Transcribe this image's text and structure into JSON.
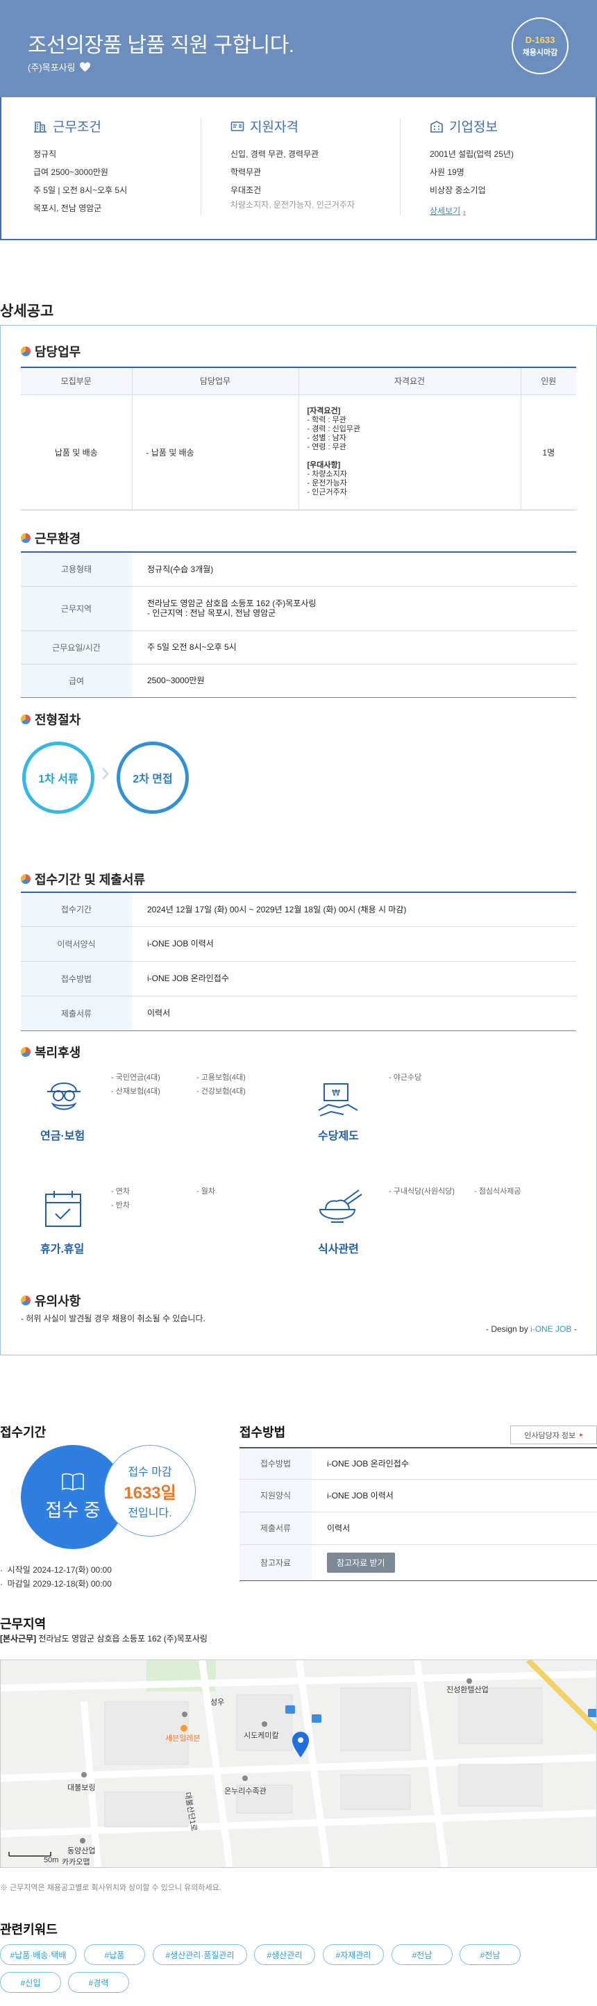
{
  "header": {
    "title": "조선의장품 납품 직원 구합니다.",
    "company": "(주)목포사링",
    "dday": "D-1633",
    "dday_label": "채용시마감"
  },
  "summary": {
    "work": {
      "heading": "근무조건",
      "lines": [
        "정규직",
        "급여 2500~3000만원",
        "주 5일 | 오전 8시~오후 5시",
        "목포시, 전남 영암군"
      ]
    },
    "qualify": {
      "heading": "지원자격",
      "lines": [
        "신입, 경력 무관, 경력무관",
        "학력무관",
        "우대조건"
      ],
      "sub": "차량소지자, 운전가능자, 인근거주자"
    },
    "company": {
      "heading": "기업정보",
      "lines": [
        "2001년 설립(업력 25년)",
        "사원 19명",
        "비상장 중소기업"
      ],
      "more": "상세보기"
    }
  },
  "detail": {
    "title": "상세공고",
    "duty": {
      "title": "담당업무",
      "headers": [
        "모집부문",
        "담당업무",
        "자격요건",
        "인원"
      ],
      "row": {
        "part": "납품 및 배송",
        "task": "- 납품 및 배송",
        "req_title": "[자격요건]",
        "req_lines": [
          "- 학력 : 무관",
          "- 경력 : 신입무관",
          "- 성별 : 남자",
          "- 연령 : 무관"
        ],
        "pref_title": "[우대사항]",
        "pref_lines": [
          "- 차량소지자",
          "- 운전가능자",
          "- 인근거주자"
        ],
        "count": "1명"
      }
    },
    "env": {
      "title": "근무환경",
      "rows": [
        {
          "k": "고용형태",
          "v": "정규직(수습 3개월)"
        },
        {
          "k": "근무지역",
          "v": "전라남도 영암군 삼호읍 소등포 162 (주)목포사링",
          "v2": "- 인근지역 : 전남 목포시, 전남 영암군"
        },
        {
          "k": "근무요일/시간",
          "v": "주 5일 오전 8시~오후 5시"
        },
        {
          "k": "급여",
          "v": "2500~3000만원"
        }
      ]
    },
    "process": {
      "title": "전형절차",
      "steps": [
        "1차 서류",
        "2차 면접"
      ]
    },
    "docs": {
      "title": "접수기간 및 제출서류",
      "rows": [
        {
          "k": "접수기간",
          "v": "2024년 12월 17일 (화) 00시 ~ 2029년 12월 18일 (화) 00시 (채용 시 마감)"
        },
        {
          "k": "이력서양식",
          "v": "i-ONE JOB 이력서"
        },
        {
          "k": "접수방법",
          "v": "i-ONE JOB 온라인접수"
        },
        {
          "k": "제출서류",
          "v": "이력서"
        }
      ]
    },
    "welfare": {
      "title": "복리후생",
      "groups": [
        {
          "label": "연금·보험",
          "icon": "pension-icon",
          "items": [
            "- 국민연금(4대)",
            "- 산재보험(4대)",
            "- 고용보험(4대)",
            "- 건강보험(4대)"
          ]
        },
        {
          "label": "수당제도",
          "icon": "allowance-icon",
          "items": [
            "- 야근수당"
          ]
        },
        {
          "label": "휴가.휴일",
          "icon": "calendar-icon",
          "items": [
            "- 연차",
            "- 반차",
            "- 월차"
          ]
        },
        {
          "label": "식사관련",
          "icon": "meal-icon",
          "items": [
            "- 구내식당(사원식당)",
            "- 점심식사제공"
          ]
        }
      ]
    },
    "notice": {
      "title": "유의사항",
      "text": "- 허위 사실이 발견될 경우 채용이 취소될 수 있습니다.",
      "design_prefix": "- Design by ",
      "design_brand": "i-ONE JOB",
      "design_suffix": " -"
    }
  },
  "apply_period": {
    "title": "접수기간",
    "status": "접수 중",
    "deadline_label": "접수 마감",
    "deadline_days": "1633일",
    "deadline_suffix": "전입니다.",
    "start": "시작일 2024-12-17(화) 00:00",
    "end": "마감일 2029-12-18(화) 00:00"
  },
  "apply_method": {
    "title": "접수방법",
    "hr_button": "인사담당자 정보",
    "rows": [
      {
        "k": "접수방법",
        "v": "i-ONE JOB 온라인접수"
      },
      {
        "k": "지원양식",
        "v": "i-ONE JOB 이력서"
      },
      {
        "k": "제출서류",
        "v": "이력서"
      },
      {
        "k": "참고자료",
        "button": "참고자료 받기"
      }
    ]
  },
  "location": {
    "title": "근무지역",
    "tag": "[본사근무]",
    "address": "전라남도 영암군 삼호읍 소등포 162 (주)목포사링",
    "pois": [
      "성우",
      "진성환텔산업",
      "세븐일레븐",
      "시도케미칼",
      "대불보링",
      "온누리수족관",
      "대불산단1로",
      "동양산업",
      "카카오맵"
    ],
    "scale": "50m",
    "note": "※ 근무지역은 채용공고별로 회사위치와 상이할 수 있으니 유의하세요."
  },
  "keywords": {
    "title": "관련키워드",
    "items": [
      "#납품·배송·택배",
      "#납품",
      "#생산관리·품질관리",
      "#생산관리",
      "#자재관리",
      "#전남",
      "#전남",
      "#신입",
      "#경력"
    ]
  },
  "colors": {
    "hero": "#6b8ebf",
    "accent": "#2d64b2",
    "cyan": "#2b9fd8",
    "deadline": "#e8782a"
  }
}
